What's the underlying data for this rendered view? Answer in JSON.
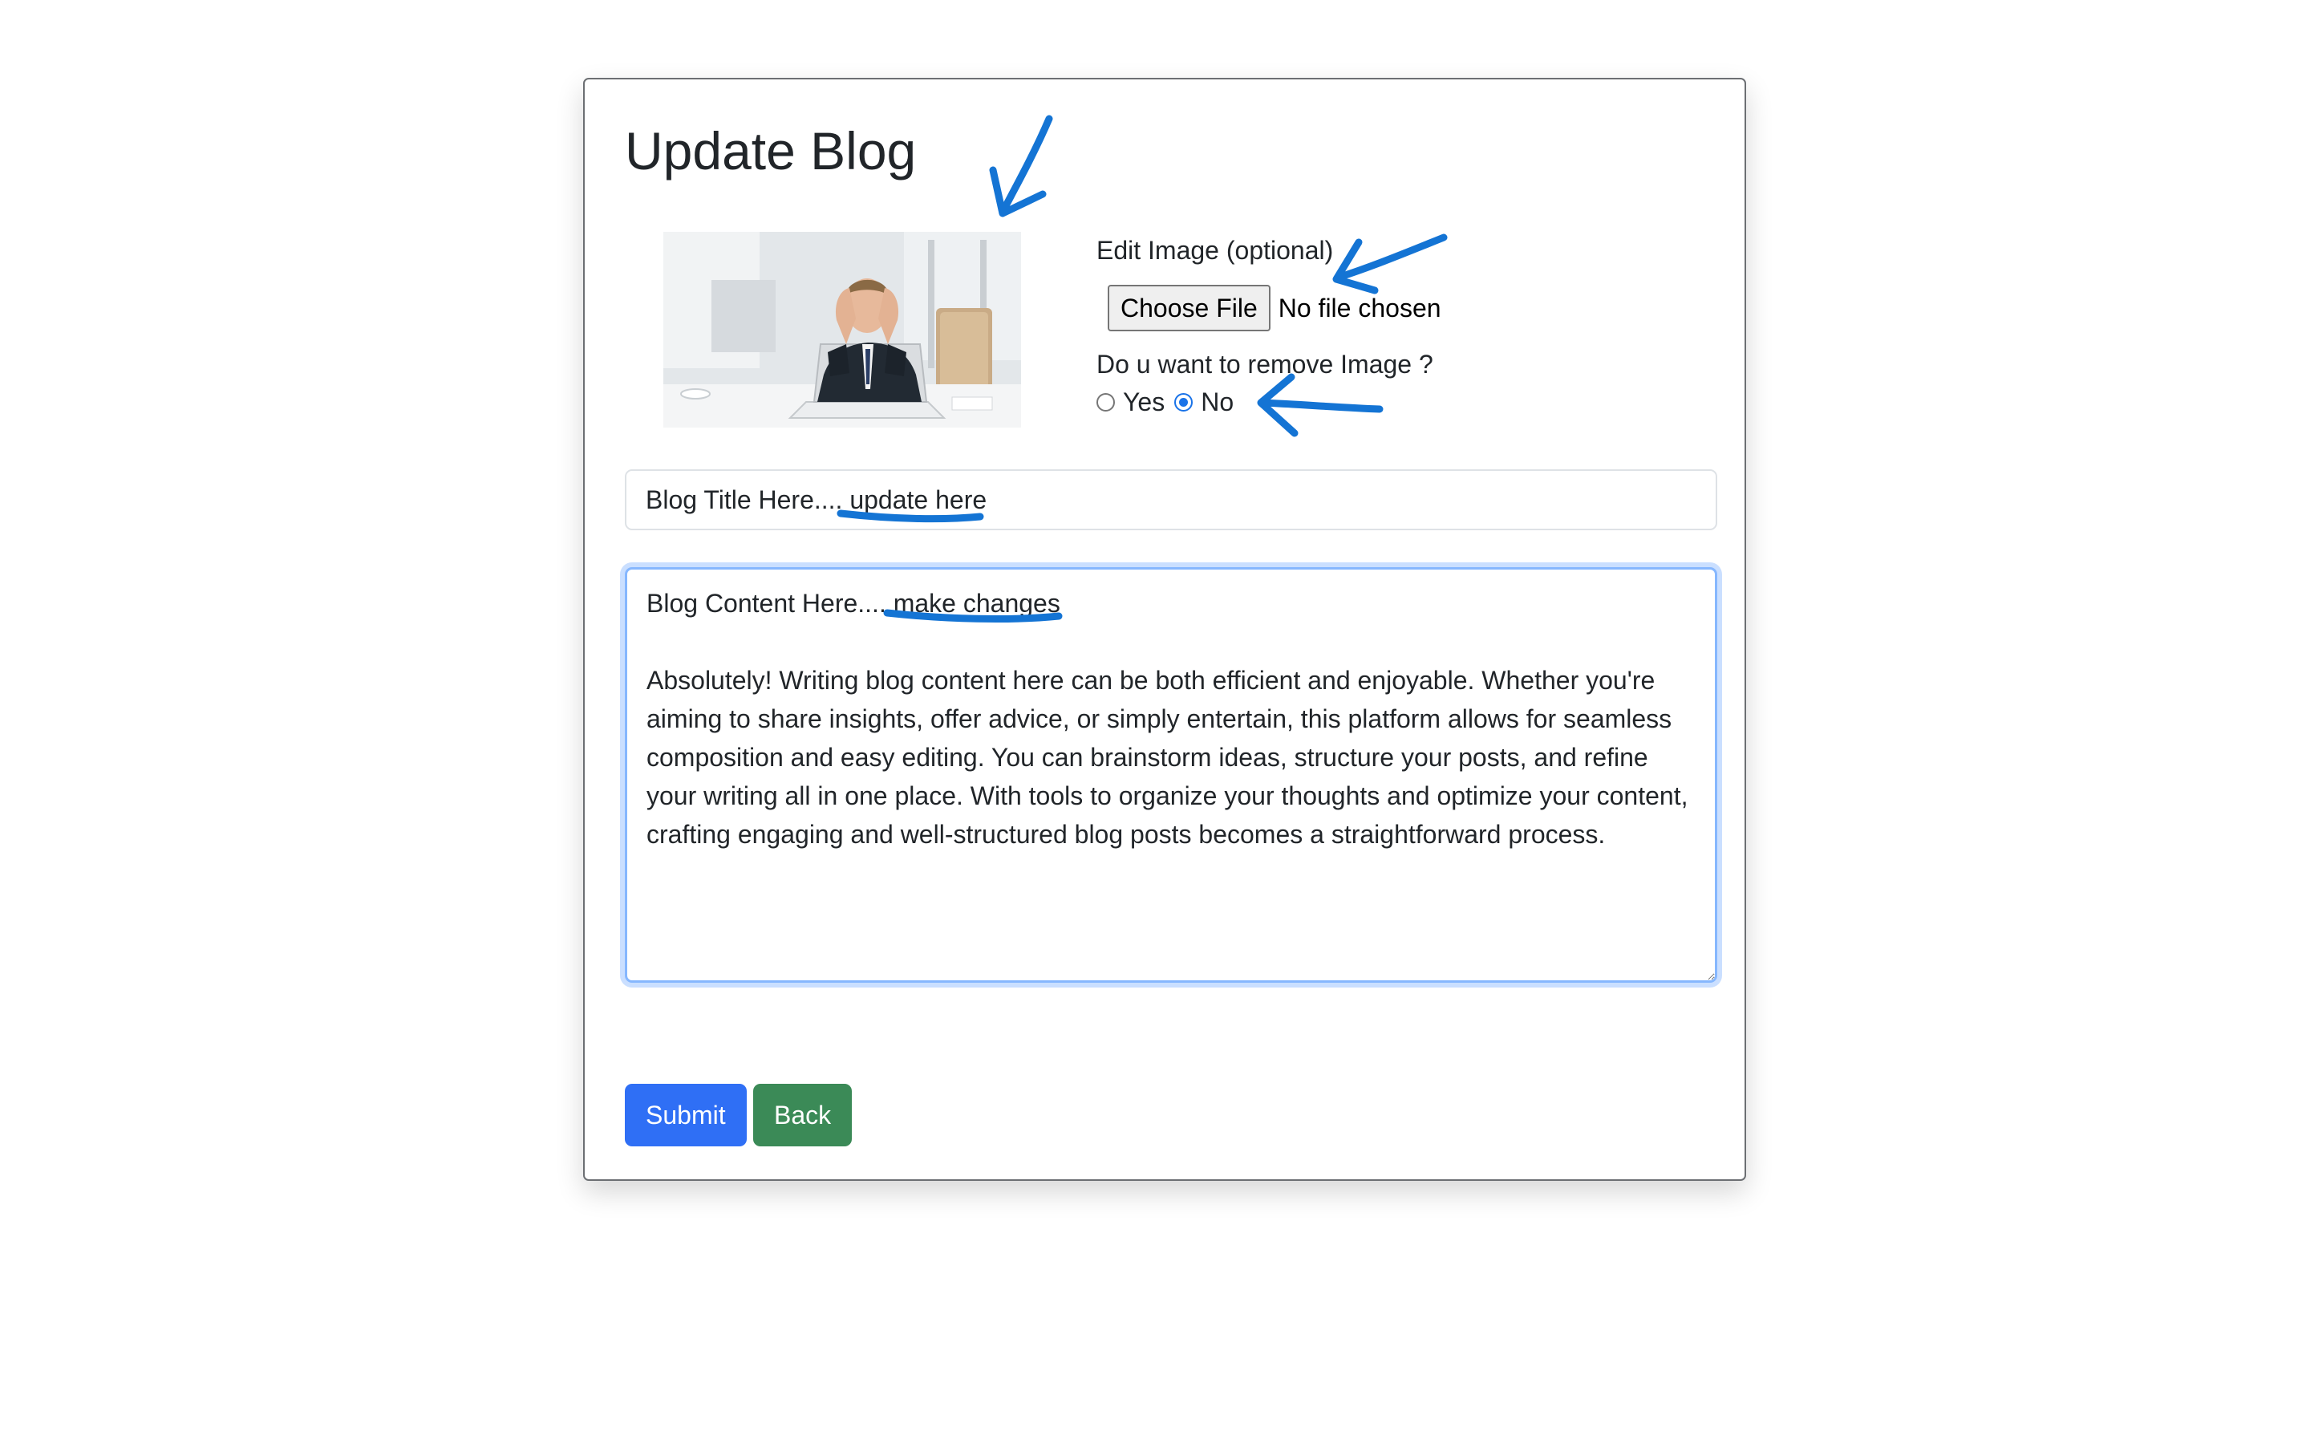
{
  "page": {
    "title": "Update Blog"
  },
  "image_section": {
    "edit_label": "Edit Image (optional)",
    "choose_file_label": "Choose File",
    "file_status": "No file chosen",
    "remove_question": "Do u want to remove Image ?",
    "options": [
      {
        "label": "Yes",
        "selected": false
      },
      {
        "label": "No",
        "selected": true
      }
    ]
  },
  "form": {
    "title_value": "Blog Title Here.... update here",
    "content_value": "Blog Content Here.... make changes\n\nAbsolutely! Writing blog content here can be both efficient and enjoyable. Whether you're aiming to share insights, offer advice, or simply entertain, this platform allows for seamless composition and easy editing. You can brainstorm ideas, structure your posts, and refine your writing all in one place. With tools to organize your thoughts and optimize your content, crafting engaging and well-structured blog posts becomes a straightforward process."
  },
  "buttons": {
    "submit": "Submit",
    "back": "Back"
  },
  "colors": {
    "annotation_ink": "#1474d4",
    "submit_bg": "#2f6ff5",
    "back_bg": "#3b8a57",
    "focus_ring": "#86b7fe"
  },
  "icons": [
    "arrow-annotation-icon",
    "underline-annotation-icon"
  ]
}
